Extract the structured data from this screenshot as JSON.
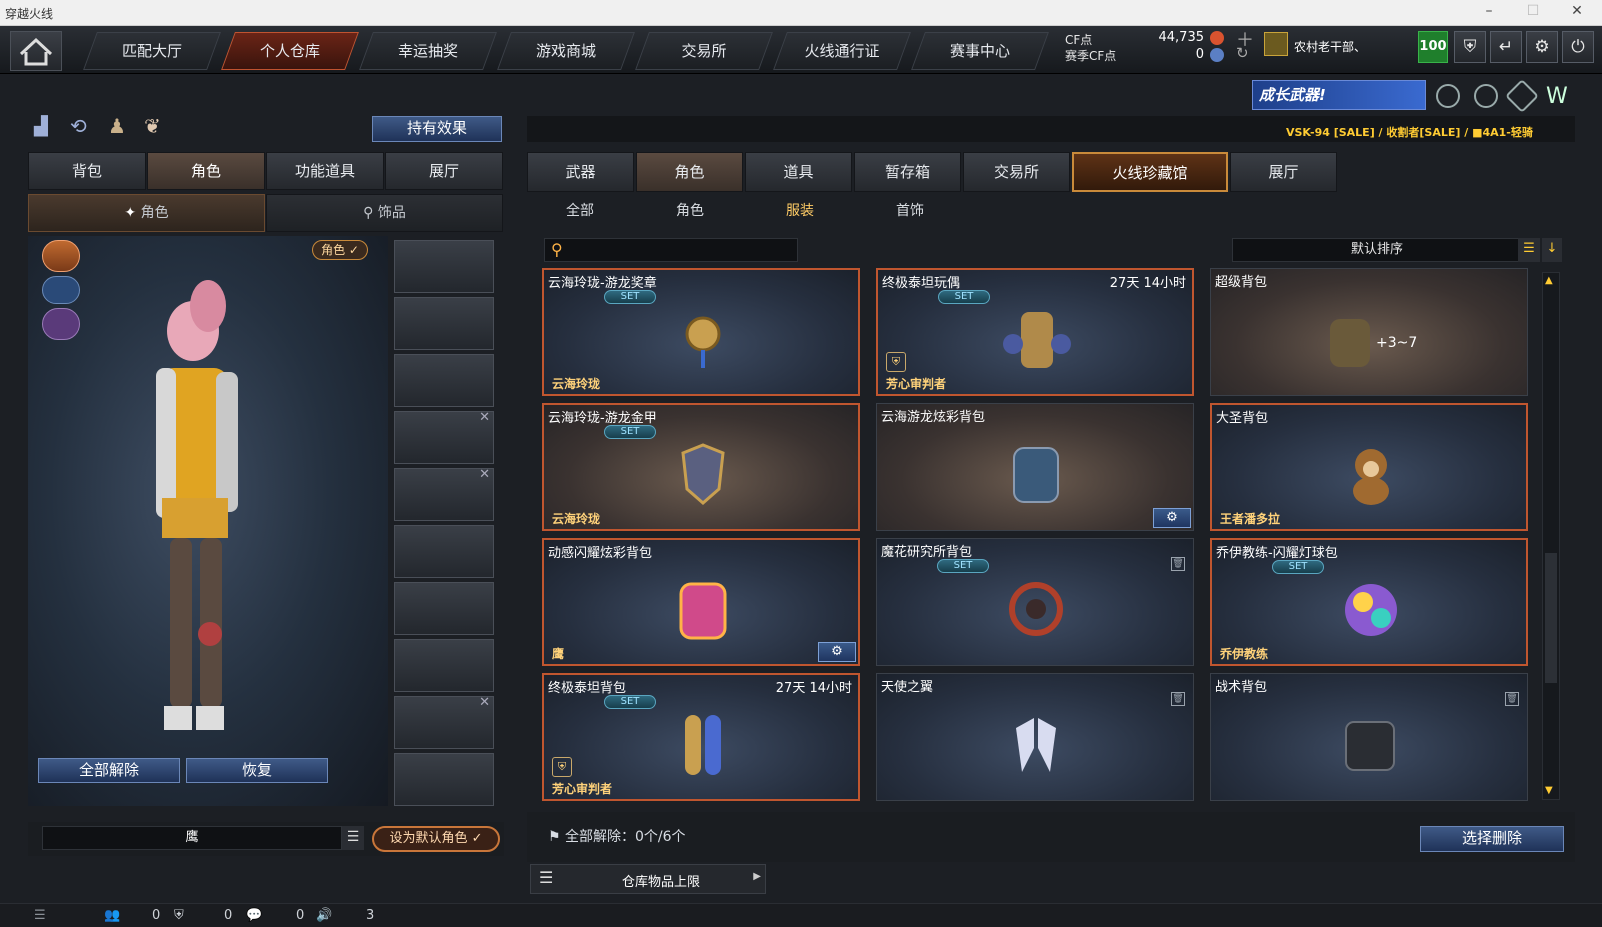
{
  "window": {
    "title": "穿越火线"
  },
  "nav": {
    "tabs": [
      "匹配大厅",
      "个人仓库",
      "幸运抽奖",
      "游戏商城",
      "交易所",
      "火线通行证",
      "赛事中心"
    ],
    "active": 1
  },
  "currency": {
    "cf_label": "CF点",
    "cf_value": "44,735",
    "season_label": "赛季CF点",
    "season_value": "0"
  },
  "user": {
    "name": "农村老干部、",
    "level": "100"
  },
  "banner": {
    "text": "成长武器!"
  },
  "marquee": {
    "text": "VSK-94 [SALE] / 收割者[SALE] / ■4A1-轻骑"
  },
  "left": {
    "effects_button": "持有效果",
    "tabs": [
      "背包",
      "角色",
      "功能道具",
      "展厅"
    ],
    "active_tab": 1,
    "subtabs": [
      "角色",
      "饰品"
    ],
    "role_badge": "角色 ✓",
    "unequip_all": "全部解除",
    "restore": "恢复",
    "char_name": "鹰",
    "set_default": "设为默认角色 ✓"
  },
  "right": {
    "tabs": [
      "武器",
      "角色",
      "道具",
      "暂存箱",
      "交易所",
      "火线珍藏馆",
      "展厅"
    ],
    "filters": [
      "全部",
      "角色",
      "服装",
      "首饰"
    ],
    "active_filter": 2,
    "sort_label": "默认排序",
    "search_placeholder": "",
    "unequip_label": "全部解除：0个/6个",
    "select_delete": "选择删除",
    "capacity": "仓库物品上限"
  },
  "cards": [
    {
      "name": "云海玲珑-游龙奖章",
      "set": "SET",
      "time": "",
      "bottom": "云海玲珑",
      "style": "blue hot",
      "icon": "medal-icon",
      "lock": false,
      "gear": false,
      "shield": false
    },
    {
      "name": "终极泰坦玩偶",
      "set": "SET",
      "time": "27天 14小时",
      "bottom": "芳心审判者",
      "style": "blue hot",
      "icon": "titan-doll-icon",
      "lock": false,
      "gear": false,
      "shield": true
    },
    {
      "name": "超级背包",
      "set": "",
      "time": "",
      "bottom": "",
      "style": "brown",
      "icon": "super-backpack-icon",
      "lock": false,
      "gear": false,
      "shield": false
    },
    {
      "name": "云海玲珑-游龙金甲",
      "set": "SET",
      "time": "",
      "bottom": "云海玲珑",
      "style": "brown hot",
      "icon": "armor-icon",
      "lock": false,
      "gear": false,
      "shield": false
    },
    {
      "name": "云海游龙炫彩背包",
      "set": "",
      "time": "",
      "bottom": "",
      "style": "brown",
      "icon": "backpack-icon",
      "lock": false,
      "gear": true,
      "shield": false
    },
    {
      "name": "大圣背包",
      "set": "",
      "time": "",
      "bottom": "王者潘多拉",
      "style": "blue hot",
      "icon": "monkey-backpack-icon",
      "lock": false,
      "gear": false,
      "shield": false
    },
    {
      "name": "动感闪耀炫彩背包",
      "set": "",
      "time": "",
      "bottom": "鹰",
      "style": "blue hot",
      "icon": "colorful-backpack-icon",
      "lock": false,
      "gear": true,
      "shield": false
    },
    {
      "name": "魔花研究所背包",
      "set": "SET",
      "time": "",
      "bottom": "",
      "style": "blue",
      "icon": "flower-icon",
      "lock": true,
      "gear": false,
      "shield": false
    },
    {
      "name": "乔伊教练-闪耀灯球包",
      "set": "SET",
      "time": "",
      "bottom": "乔伊教练",
      "style": "blue hot",
      "icon": "disco-ball-icon",
      "lock": false,
      "gear": false,
      "shield": false
    },
    {
      "name": "终极泰坦背包",
      "set": "SET",
      "time": "27天 14小时",
      "bottom": "芳心审判者",
      "style": "blue hot",
      "icon": "titan-backpack-icon",
      "lock": false,
      "gear": false,
      "shield": true
    },
    {
      "name": "天使之翼",
      "set": "",
      "time": "",
      "bottom": "",
      "style": "blue",
      "icon": "wings-icon",
      "lock": true,
      "gear": false,
      "shield": false
    },
    {
      "name": "战术背包",
      "set": "",
      "time": "",
      "bottom": "",
      "style": "blue",
      "icon": "tactical-backpack-icon",
      "lock": true,
      "gear": false,
      "shield": false
    }
  ],
  "status": {
    "c1": "0",
    "c2": "0",
    "c3": "0",
    "c4": "3"
  }
}
